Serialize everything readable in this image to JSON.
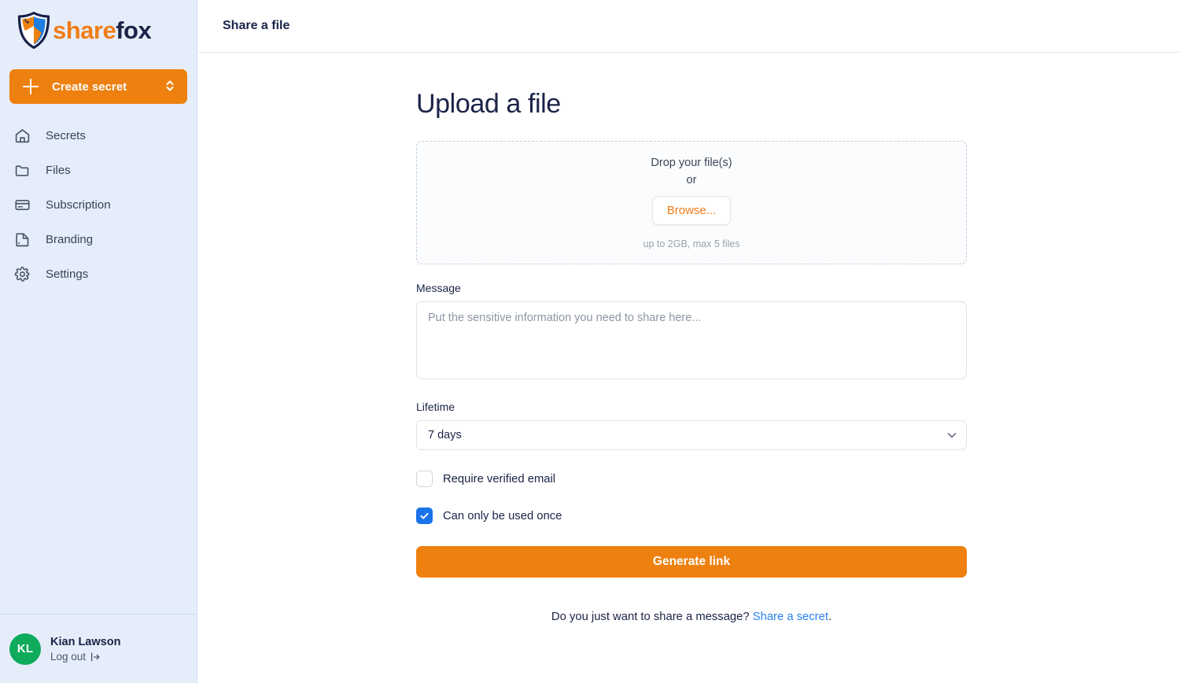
{
  "brand": {
    "word_part_1": "share",
    "word_part_2": "fox",
    "logo_icon": "fox-shield-logo",
    "orange": "#ee8010",
    "navy": "#1b2347",
    "blue_accent": "#1a73e8",
    "avatar_green": "#0dab5b"
  },
  "sidebar": {
    "create_button": {
      "label": "Create secret",
      "plus_icon": "plus-icon",
      "chevron_icon": "chevron-up-down-icon"
    },
    "items": [
      {
        "label": "Secrets",
        "icon": "home-icon"
      },
      {
        "label": "Files",
        "icon": "folder-icon"
      },
      {
        "label": "Subscription",
        "icon": "credit-card-icon"
      },
      {
        "label": "Branding",
        "icon": "palette-icon"
      },
      {
        "label": "Settings",
        "icon": "gear-icon"
      }
    ],
    "user": {
      "initials": "KL",
      "name": "Kian Lawson",
      "logout_label": "Log out",
      "logout_icon": "logout-arrow-icon"
    }
  },
  "topbar": {
    "title": "Share a file"
  },
  "main": {
    "page_title": "Upload a file",
    "dropzone": {
      "line1": "Drop your file(s)",
      "or": "or",
      "browse_label": "Browse...",
      "hint": "up to 2GB, max 5 files"
    },
    "message": {
      "label": "Message",
      "placeholder": "Put the sensitive information you need to share here...",
      "value": ""
    },
    "lifetime": {
      "label": "Lifetime",
      "selected": "7 days",
      "options": [
        "7 days"
      ],
      "chevron_icon": "chevron-down-icon"
    },
    "checkboxes": [
      {
        "label": "Require verified email",
        "checked": false
      },
      {
        "label": "Can only be used once",
        "checked": true
      }
    ],
    "submit_label": "Generate link",
    "footnote": {
      "text": "Do you just want to share a message? ",
      "link_label": "Share a secret",
      "suffix": "."
    }
  }
}
